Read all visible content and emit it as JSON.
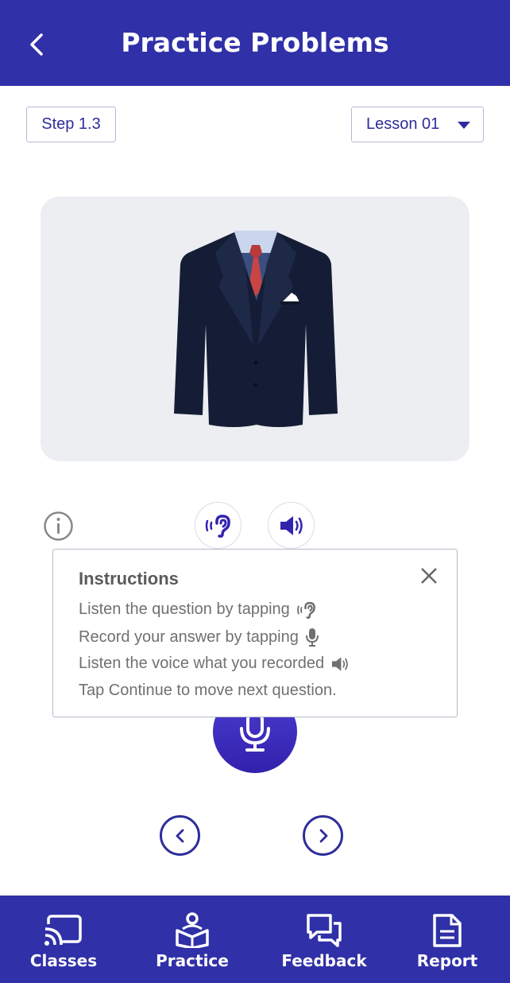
{
  "header": {
    "title": "Practice Problems"
  },
  "controls": {
    "step": "Step 1.3",
    "lesson": "Lesson 01"
  },
  "instructions": {
    "title": "Instructions",
    "lines": [
      "Listen the question by tapping",
      "Record your answer by tapping",
      "Listen the voice what you recorded",
      "Tap Continue to move next question."
    ]
  },
  "bottom_nav": {
    "items": [
      {
        "label": "Classes",
        "icon": "cast-icon"
      },
      {
        "label": "Practice",
        "icon": "book-user-icon"
      },
      {
        "label": "Feedback",
        "icon": "chat-bubbles-icon"
      },
      {
        "label": "Report",
        "icon": "document-icon"
      }
    ]
  },
  "colors": {
    "primary": "#3030a8",
    "card_bg": "#eceef2",
    "accent_text": "#2d2d9a"
  }
}
